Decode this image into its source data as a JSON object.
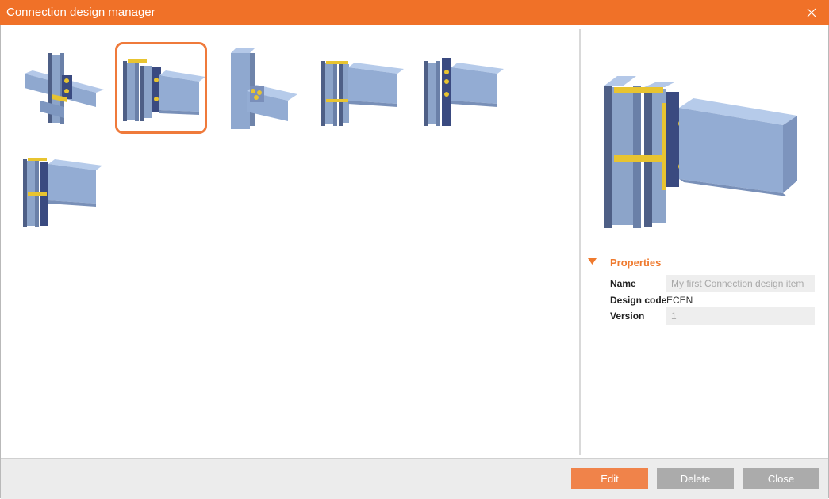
{
  "window": {
    "title": "Connection design manager",
    "close_icon": "close-icon"
  },
  "gallery": {
    "items": [
      {
        "icon": "cross-joint-connection-icon",
        "selected": false
      },
      {
        "icon": "end-plate-beam-to-column-connection-icon",
        "selected": true
      },
      {
        "icon": "hollow-section-tee-connection-icon",
        "selected": false
      },
      {
        "icon": "stiffened-end-plate-connection-icon",
        "selected": false
      },
      {
        "icon": "bolted-end-plate-connection-icon",
        "selected": false
      },
      {
        "icon": "haunched-end-plate-connection-icon",
        "selected": false
      }
    ]
  },
  "preview": {
    "icon": "connection-preview-icon"
  },
  "properties": {
    "header": "Properties",
    "name_label": "Name",
    "name_placeholder": "My first Connection design item",
    "design_code_label": "Design code",
    "design_code_value": "ECEN",
    "version_label": "Version",
    "version_value": "1"
  },
  "footer": {
    "edit_label": "Edit",
    "delete_label": "Delete",
    "close_label": "Close"
  },
  "colors": {
    "accent": "#f07128",
    "selection": "#ef7a3b",
    "steel": "#8fa8cf",
    "plate": "#3a4a80",
    "weld": "#e8c430",
    "button_primary": "#f0834a",
    "button_secondary": "#ababab"
  }
}
